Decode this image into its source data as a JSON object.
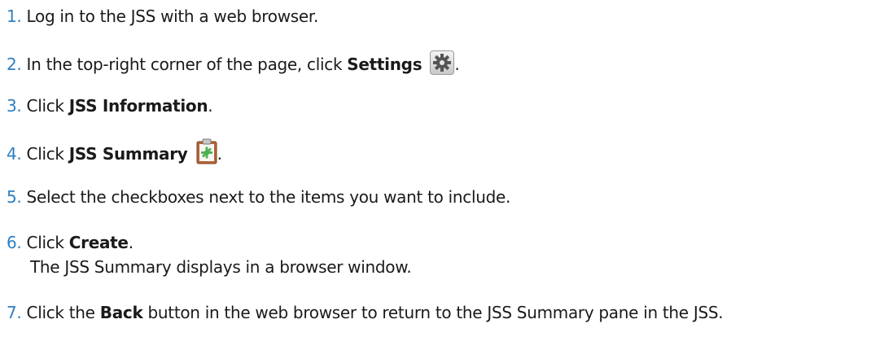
{
  "steps": [
    {
      "num": "1.",
      "parts": [
        "Log in to the JSS with a web browser."
      ]
    },
    {
      "num": "2.",
      "text": "In the top-right corner of the page, click ",
      "bold": "Settings",
      "after": "."
    },
    {
      "num": "3.",
      "text": "Click ",
      "bold": "JSS Information",
      "after": "."
    },
    {
      "num": "4.",
      "text": "Click ",
      "bold": "JSS Summary",
      "after": "."
    },
    {
      "num": "5.",
      "parts": [
        "Select the checkboxes next to the items you want to include."
      ]
    },
    {
      "num": "6.",
      "text": "Click ",
      "bold": "Create",
      "after": ".",
      "sub": "The JSS Summary displays in a browser window."
    },
    {
      "num": "7.",
      "text": "Click the ",
      "bold": "Back",
      "after": " button in the web browser to return to the JSS Summary pane in the JSS."
    }
  ],
  "icons": {
    "settings": "gear-icon",
    "summary": "clipboard-icon"
  },
  "colors": {
    "number": "#2f7fc1",
    "text": "#1a1a1a"
  }
}
